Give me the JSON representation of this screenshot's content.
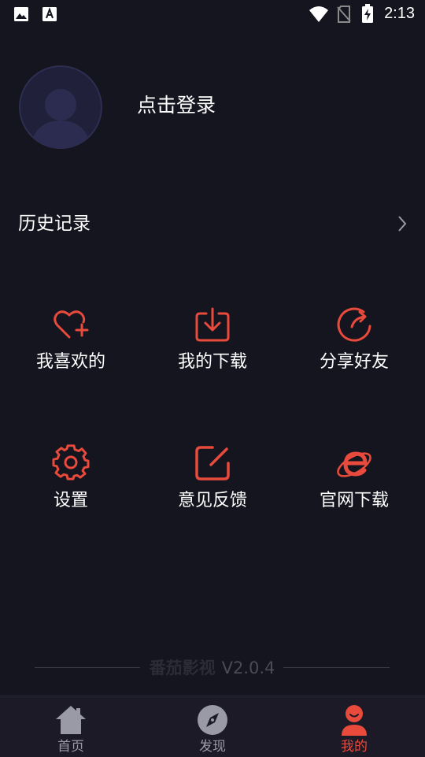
{
  "status_bar": {
    "time": "2:13",
    "icons": [
      "image-icon",
      "text-a-icon",
      "wifi-icon",
      "no-sim-icon",
      "battery-charging-icon"
    ]
  },
  "profile": {
    "login_label": "点击登录"
  },
  "history": {
    "label": "历史记录"
  },
  "menu": {
    "items": [
      {
        "label": "我喜欢的",
        "icon": "heart-plus-icon"
      },
      {
        "label": "我的下载",
        "icon": "download-icon"
      },
      {
        "label": "分享好友",
        "icon": "share-icon"
      },
      {
        "label": "设置",
        "icon": "gear-icon"
      },
      {
        "label": "意见反馈",
        "icon": "feedback-edit-icon"
      },
      {
        "label": "官网下载",
        "icon": "browser-e-icon"
      }
    ]
  },
  "version": {
    "brand": "番茄影视",
    "number": "V2.0.4"
  },
  "bottom_nav": {
    "items": [
      {
        "label": "首页",
        "icon": "home-icon"
      },
      {
        "label": "发现",
        "icon": "compass-icon"
      },
      {
        "label": "我的",
        "icon": "user-icon"
      }
    ],
    "active_index": 2
  },
  "colors": {
    "background": "#15151f",
    "accent": "#e84a3c",
    "nav_background": "#1b1a26",
    "inactive": "#9a9aa6"
  }
}
